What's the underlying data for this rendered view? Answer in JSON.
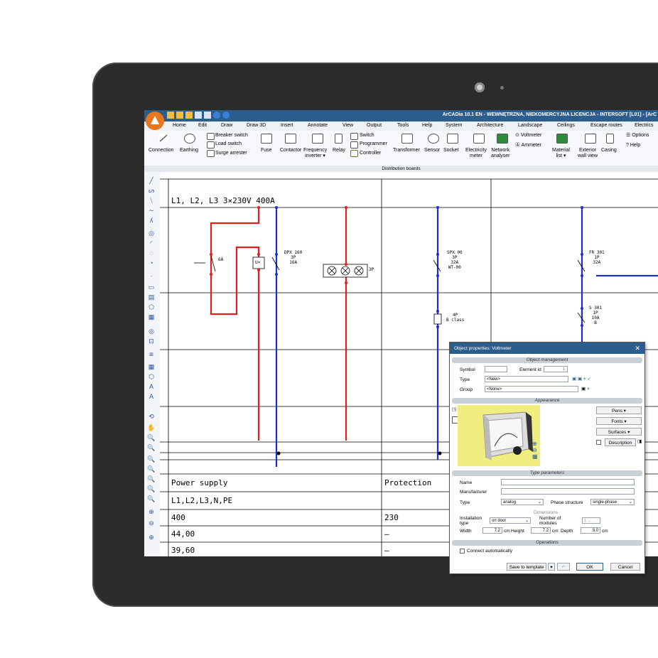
{
  "window": {
    "title": "ArCADia 10.1 EN - WEWNĘTRZNA, NIEKOMERCYJNA LICENCJA - INTERSOFT [L01] - [ArC"
  },
  "menu": [
    "Home",
    "Edit",
    "Draw",
    "Draw 3D",
    "Insert",
    "Annotate",
    "View",
    "Output",
    "Tools",
    "Help",
    "System",
    "Architecture",
    "Landscape",
    "Ceilings",
    "Escape routes",
    "Electrics"
  ],
  "ribbon": {
    "connection": "Connection",
    "earthing": "Earthing",
    "breaker_switch": "Breaker switch",
    "load_switch": "Load switch",
    "surge_arrester": "Surge arrester",
    "fuse": "Fuse",
    "contactor": "Contactor",
    "frequency": "Frequency",
    "inverter": "inverter ▾",
    "relay": "Relay",
    "switch": "Switch",
    "programmer": "Programmer",
    "controller": "Controller",
    "transformer": "Transformer",
    "sensor": "Sensor",
    "socket": "Socket",
    "electricity": "Electricity",
    "meter": "meter",
    "network": "Network",
    "analyser": "analyser",
    "voltmeter": "Voltmeter",
    "ammeter": "Ammeter",
    "material": "Material",
    "list": "list ▾",
    "exterior": "Exterior",
    "wall_view": "wall view",
    "casing": "Casing",
    "options": "Options",
    "help": "Help",
    "group_label": "Distribution boards"
  },
  "drawing": {
    "header": "L1, L2, L3 3×230V 400A",
    "fuse_label": "6A",
    "uc_label": "U>",
    "dpx": [
      "DPX 160",
      "3P",
      "16A"
    ],
    "lamps_label": "3P",
    "spx": [
      "SPX 00",
      "3P",
      "32A",
      "WT-00"
    ],
    "rcd": [
      "4P",
      "B class"
    ],
    "fr": [
      "FR 301",
      "1P",
      "32A"
    ],
    "s301": [
      "S 301",
      "1P",
      "10A",
      "B"
    ],
    "table": {
      "r1c1": "Power supply",
      "r1c2": "Protection",
      "r2c1": "L1,L2,L3,N,PE",
      "r3c1": "400",
      "r3c2": "230",
      "r4c1": "44,00",
      "r4c2": "–",
      "r5c1": "39,60",
      "r5c2": "–"
    }
  },
  "dialog": {
    "title": "Object properties: Voltmeter",
    "sec_management": "Object management",
    "symbol_label": "Symbol",
    "element_id_label": "Element id",
    "element_id_value": "1",
    "type_label": "Type",
    "type_value": "<New>",
    "group_label": "Group",
    "group_value": "<None>",
    "sec_appearance": "Appearance",
    "pens": "Pens",
    "fonts": "Fonts",
    "surfaces": "Surfaces",
    "description": "Description",
    "sec_type_params": "Type parameters",
    "name_label": "Name",
    "manufacturer_label": "Manufacturer",
    "ptype_label": "Type",
    "ptype_value": "analog",
    "phase_label": "Phase structure",
    "phase_value": "single-phase",
    "dimensions_label": "Dimensions",
    "installation_label": "Installation type",
    "installation_value": "on door",
    "modules_label": "Number of modules",
    "modules_value": "1",
    "width_label": "Width",
    "width_value": "7.2",
    "height_label": "Height",
    "height_value": "7.2",
    "depth_label": "Depth",
    "depth_value": "3.0",
    "unit": "cm",
    "sec_operations": "Operations",
    "connect_auto": "Connect automatically",
    "save_template": "Save to template",
    "ok": "OK",
    "cancel": "Cancel"
  },
  "colors": {
    "phase_red": "#e0201c",
    "neutral_blue": "#1a2fd6",
    "title_blue": "#2d5d8c",
    "accent_orange": "#e8761c"
  }
}
